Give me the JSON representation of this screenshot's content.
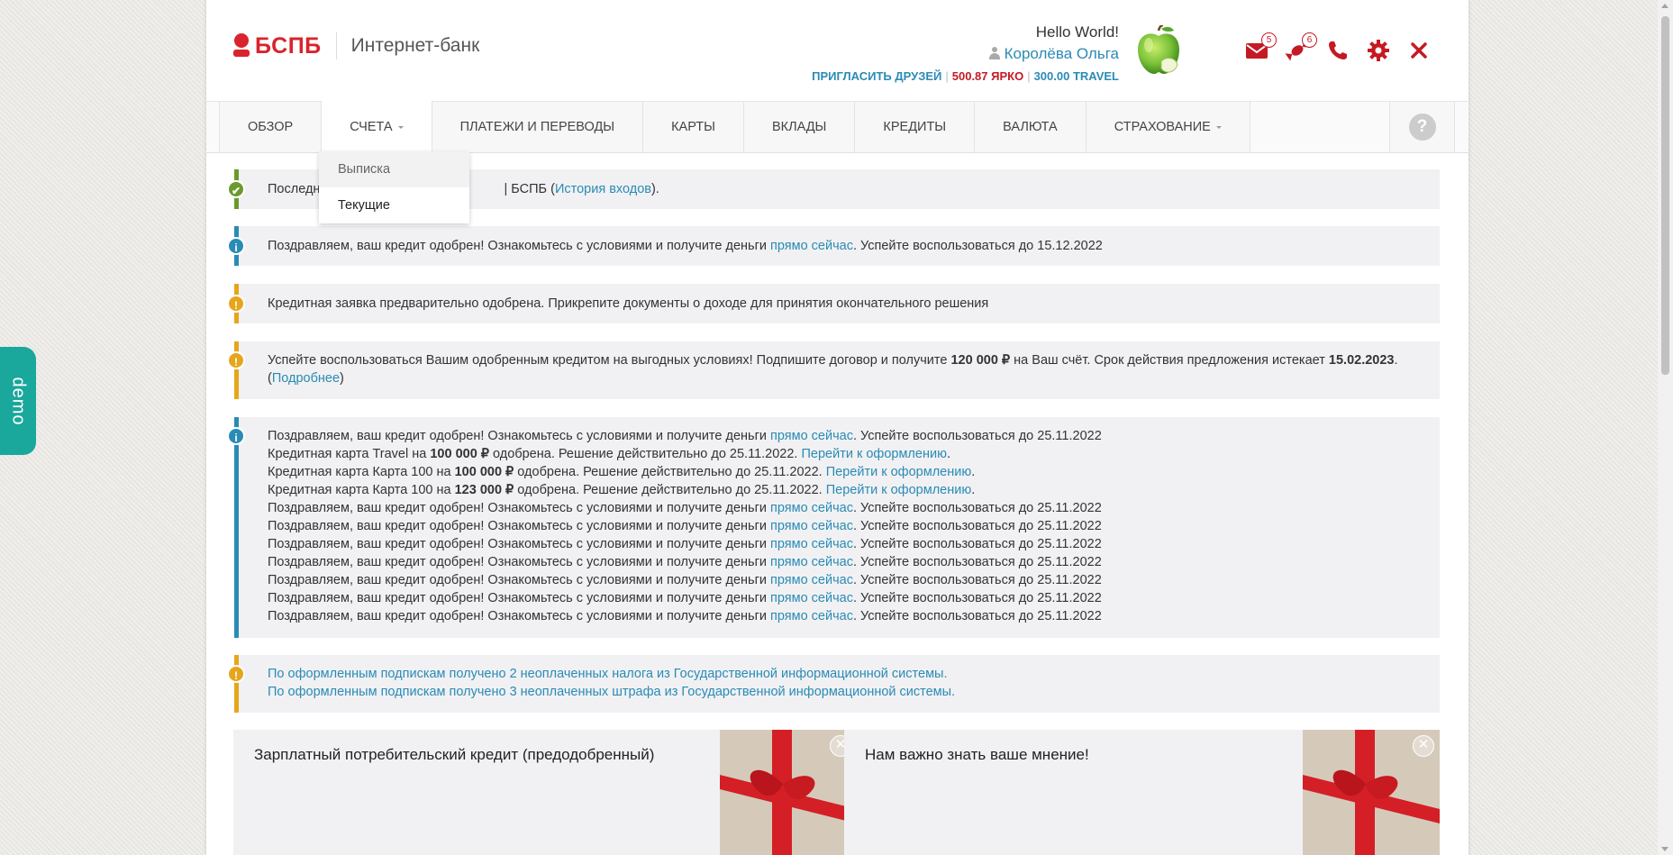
{
  "demo_tab": "demo",
  "header": {
    "logo_text": "БСПБ",
    "app_title": "Интернет-банк",
    "greeting": "Hello World!",
    "user_name": "Королёва Ольга",
    "invite_friends": "ПРИГЛАСИТЬ ДРУЗЕЙ",
    "separator": "|",
    "yarko_balance": "500.87 ЯРКО",
    "travel_balance": "300.00 TRAVEL",
    "messages_count": "5",
    "gifts_count": "6"
  },
  "nav": {
    "items": [
      {
        "label": "ОБЗОР"
      },
      {
        "label": "СЧЕТА"
      },
      {
        "label": "ПЛАТЕЖИ И ПЕРЕВОДЫ"
      },
      {
        "label": "КАРТЫ"
      },
      {
        "label": "ВКЛАДЫ"
      },
      {
        "label": "КРЕДИТЫ"
      },
      {
        "label": "ВАЛЮТА"
      },
      {
        "label": "СТРАХОВАНИЕ"
      }
    ],
    "help": "?",
    "dropdown": [
      {
        "label": "Выписка"
      },
      {
        "label": "Текущие"
      }
    ]
  },
  "alerts": {
    "last_login_prefix": "Последни",
    "last_login_suffix": "| БСПБ (",
    "login_history_link": "История входов",
    "last_login_end": ").",
    "credit_approved": {
      "text": "Поздравляем, ваш кредит одобрен! Ознакомьтесь с условиями и получите деньги ",
      "link": "прямо сейчас",
      "tail": ". Успейте воспользоваться до 15.12.2022"
    },
    "pre_approved": "Кредитная заявка предварительно одобрена. Прикрепите документы о доходе для принятия окончательного решения",
    "hurry": {
      "text1": "Успейте воспользоваться Вашим одобренным кредитом на выгодных условиях! Подпишите договор и получите ",
      "amount": "120 000 ₽",
      "text2": " на Ваш счёт. Срок действия предложения истекает ",
      "date": "15.02.2023",
      "text3": ".",
      "paren_open": "(",
      "more_link": "Подробнее",
      "paren_close": ")"
    },
    "multi": {
      "congrats_text": "Поздравляем, ваш кредит одобрен! Ознакомьтесь с условиями и получите деньги ",
      "congrats_link": "прямо сейчас",
      "congrats_tail": ". Успейте воспользоваться до 25.11.2022",
      "card_travel_prefix": "Кредитная карта Travel на ",
      "card_100_prefix": "Кредитная карта Карта 100 на ",
      "amount_100k": "100 000 ₽",
      "amount_123k": "123 000 ₽",
      "card_approved_text": " одобрена. Решение действительно до 25.11.2022. ",
      "apply_link": "Перейти к оформлению",
      "period": "."
    },
    "gis": {
      "line1": "По оформленным подпискам получено 2 неоплаченных налога из Государственной информационной системы.",
      "line2": "По оформленным подпискам получено 3 неоплаченных штрафа из Государственной информационной системы."
    }
  },
  "promos": [
    {
      "title": "Зарплатный потребительский кредит (предодобренный)"
    },
    {
      "title": "Нам важно знать ваше мнение!"
    }
  ],
  "colors": {
    "brand_red": "#d9232d",
    "link_blue": "#2a8bb5",
    "success_green": "#6a9a2c",
    "warning_yellow": "#e6a61b",
    "demo_teal": "#1aa79c"
  }
}
